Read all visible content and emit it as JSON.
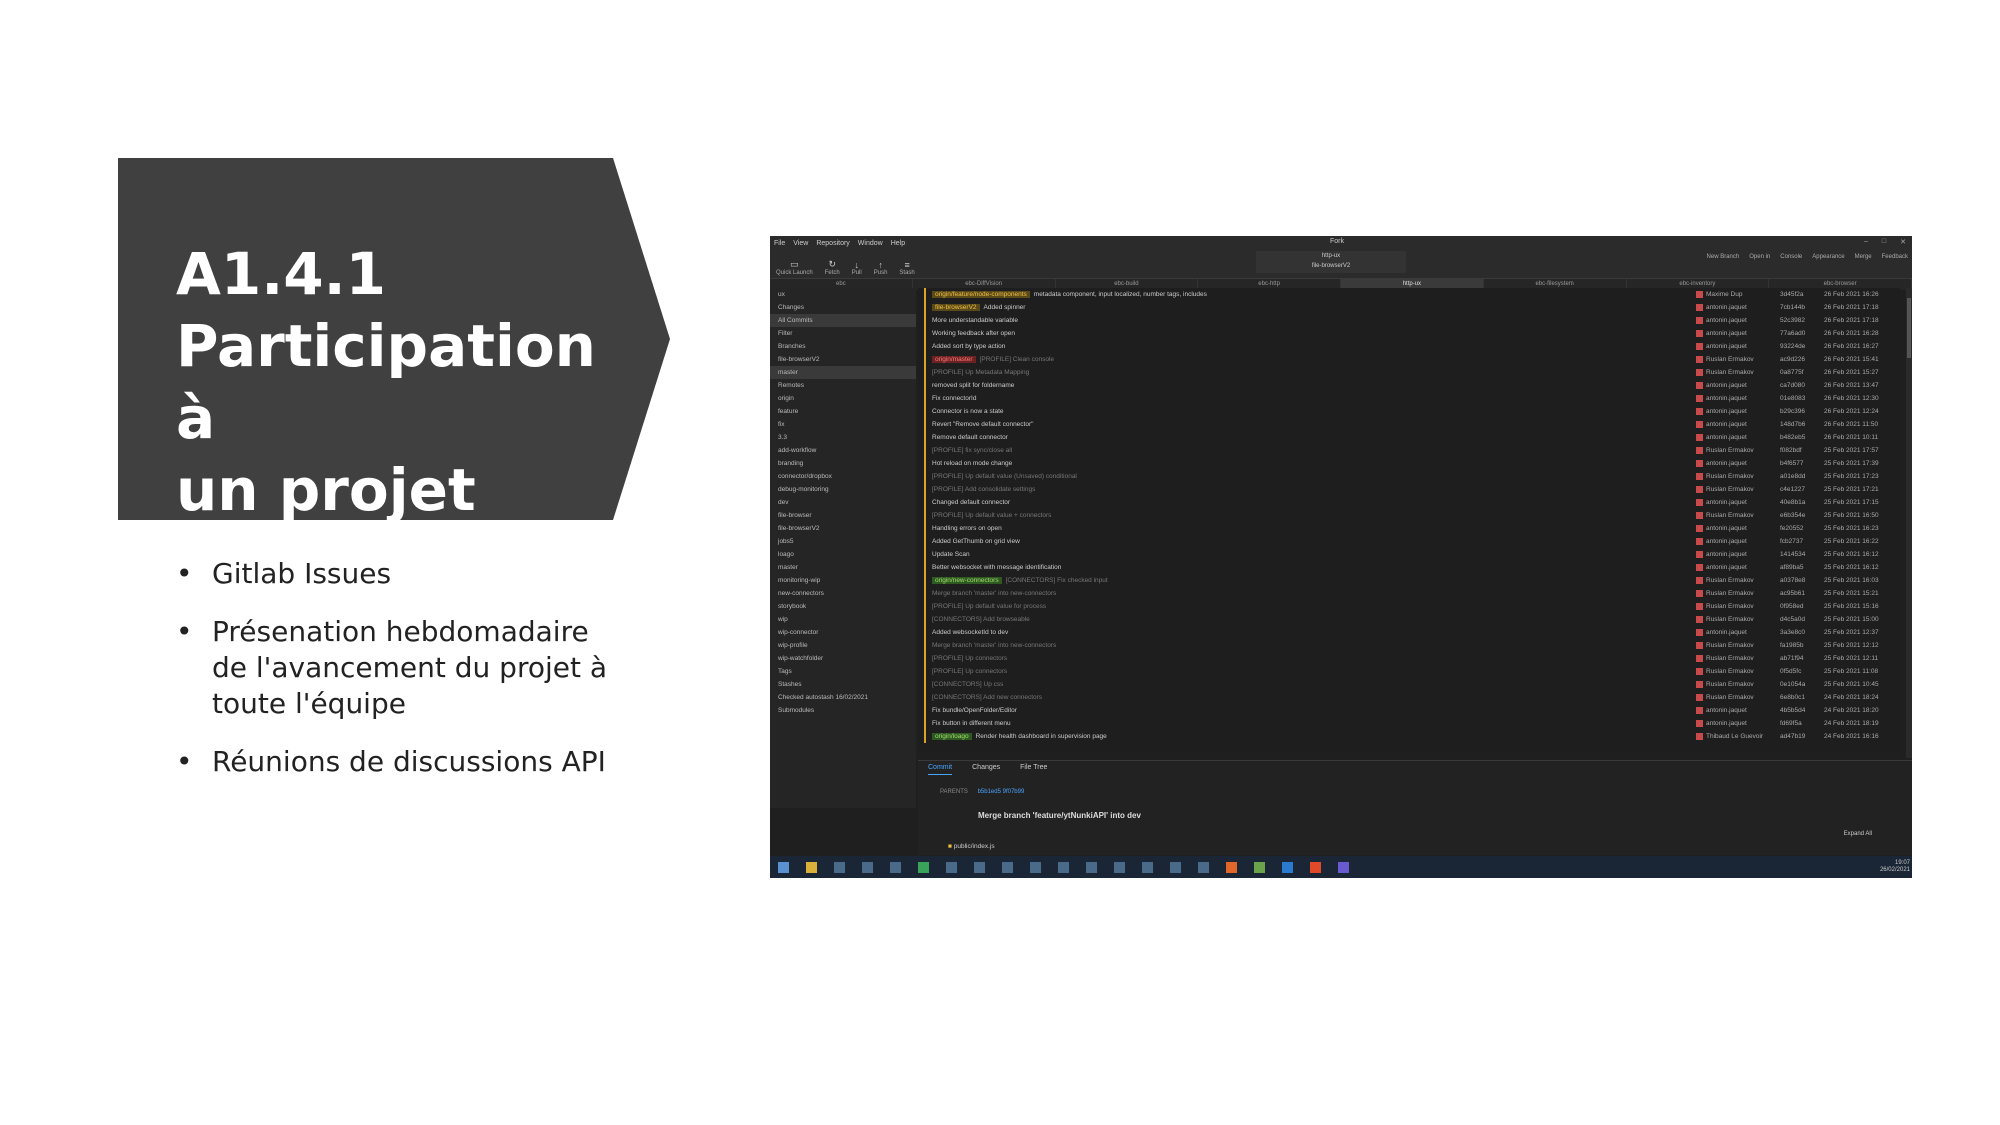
{
  "slide": {
    "title_lines": [
      "A1.4.1",
      "Participation à",
      "un projet"
    ],
    "bullets": [
      "Gitlab Issues",
      "Présenation hebdomadaire de l'avancement du projet à toute l'équipe",
      "Réunions de discussions API"
    ],
    "title_bg": "#404040"
  },
  "screenshot": {
    "menu": [
      "File",
      "View",
      "Repository",
      "Window",
      "Help"
    ],
    "app_title": "Fork",
    "toolbar": [
      {
        "icon": "folder-icon",
        "label": "Quick Launch"
      },
      {
        "icon": "fetch-icon",
        "label": "Fetch"
      },
      {
        "icon": "pull-icon",
        "label": "Pull"
      },
      {
        "icon": "push-icon",
        "label": "Push"
      },
      {
        "icon": "stash-icon",
        "label": "Stash"
      }
    ],
    "repo": {
      "name": "http-ux",
      "branch": "file-browserV2"
    },
    "right_tools": [
      "New Branch",
      "Open in",
      "Console",
      "Appearance",
      "Merge",
      "Feedback"
    ],
    "tabs": [
      "ebc",
      "ebc-DiffVision",
      "ebc-build",
      "ebc-http",
      "http-ux",
      "ebc-filesystem",
      "ebc-inventory",
      "ebc-browser"
    ],
    "active_tab": "http-ux",
    "sidebar": [
      "ux",
      "Changes",
      "All Commits",
      "Filter",
      "Branches",
      "file-browserV2",
      "master",
      "Remotes",
      "origin",
      "feature",
      "fix",
      "3.3",
      "add-workflow",
      "branding",
      "connector/dropbox",
      "debug-monitoring",
      "dev",
      "file-browser",
      "file-browserV2",
      "jobs5",
      "loago",
      "master",
      "monitoring-wip",
      "new-connectors",
      "storybook",
      "wip",
      "wip-connector",
      "wip-profile",
      "wip-watchfolder",
      "Tags",
      "Stashes",
      "Checked autostash 16/02/2021",
      "Submodules"
    ],
    "commits": [
      {
        "tag": "origin/feature/node-components",
        "msg": "metadata component, input localized, number tags, includes",
        "author": "Maxime Dup",
        "sha": "3d45f2a",
        "date": "26 Feb 2021 16:26"
      },
      {
        "tag": "file-browserV2",
        "msg": "Added spinner",
        "author": "antonin.jaquet",
        "sha": "7cb144b",
        "date": "26 Feb 2021 17:18"
      },
      {
        "tag": "",
        "msg": "More understandable variable",
        "author": "antonin.jaquet",
        "sha": "52c3982",
        "date": "26 Feb 2021 17:18"
      },
      {
        "tag": "",
        "msg": "Working feedback after open",
        "author": "antonin.jaquet",
        "sha": "77a6ad0",
        "date": "26 Feb 2021 16:28"
      },
      {
        "tag": "",
        "msg": "Added sort by type action",
        "author": "antonin.jaquet",
        "sha": "93224de",
        "date": "26 Feb 2021 16:27"
      },
      {
        "tag": "origin/master",
        "msg": "[PROFILE] Clean console",
        "author": "Ruslan Ermakov",
        "sha": "ac9d226",
        "date": "26 Feb 2021 15:41"
      },
      {
        "tag": "",
        "msg": "[PROFILE] Up Metadata Mapping",
        "author": "Ruslan Ermakov",
        "sha": "0a8775f",
        "date": "26 Feb 2021 15:27"
      },
      {
        "tag": "",
        "msg": "removed split for foldername",
        "author": "antonin.jaquet",
        "sha": "ca7d080",
        "date": "26 Feb 2021 13:47"
      },
      {
        "tag": "",
        "msg": "Fix connectorId",
        "author": "antonin.jaquet",
        "sha": "01e8083",
        "date": "26 Feb 2021 12:30"
      },
      {
        "tag": "",
        "msg": "Connector is now a state",
        "author": "antonin.jaquet",
        "sha": "b29c396",
        "date": "26 Feb 2021 12:24"
      },
      {
        "tag": "",
        "msg": "Revert \"Remove default connector\"",
        "author": "antonin.jaquet",
        "sha": "148d7b6",
        "date": "26 Feb 2021 11:50"
      },
      {
        "tag": "",
        "msg": "Remove default connector",
        "author": "antonin.jaquet",
        "sha": "b482eb5",
        "date": "26 Feb 2021 10:11"
      },
      {
        "tag": "",
        "msg": "[PROFILE] fix sync/close all",
        "author": "Ruslan Ermakov",
        "sha": "f082bdf",
        "date": "25 Feb 2021 17:57"
      },
      {
        "tag": "",
        "msg": "Hot reload on mode change",
        "author": "antonin.jaquet",
        "sha": "b4f6577",
        "date": "25 Feb 2021 17:39"
      },
      {
        "tag": "",
        "msg": "[PROFILE] Up default value (Unsaved) conditional",
        "author": "Ruslan Ermakov",
        "sha": "a01e8dd",
        "date": "25 Feb 2021 17:23"
      },
      {
        "tag": "",
        "msg": "[PROFILE] Add consolidate settings",
        "author": "Ruslan Ermakov",
        "sha": "c4e1227",
        "date": "25 Feb 2021 17:21"
      },
      {
        "tag": "",
        "msg": "Changed default connector",
        "author": "antonin.jaquet",
        "sha": "40e8b1a",
        "date": "25 Feb 2021 17:15"
      },
      {
        "tag": "",
        "msg": "[PROFILE] Up default value + connectors",
        "author": "Ruslan Ermakov",
        "sha": "e6b354e",
        "date": "25 Feb 2021 16:50"
      },
      {
        "tag": "",
        "msg": "Handling errors on open",
        "author": "antonin.jaquet",
        "sha": "fe20552",
        "date": "25 Feb 2021 16:23"
      },
      {
        "tag": "",
        "msg": "Added GetThumb on grid view",
        "author": "antonin.jaquet",
        "sha": "fcb2737",
        "date": "25 Feb 2021 16:22"
      },
      {
        "tag": "",
        "msg": "Update Scan",
        "author": "antonin.jaquet",
        "sha": "1414534",
        "date": "25 Feb 2021 16:12"
      },
      {
        "tag": "",
        "msg": "Better websocket with message identification",
        "author": "antonin.jaquet",
        "sha": "af89ba5",
        "date": "25 Feb 2021 16:12"
      },
      {
        "tag": "origin/new-connectors",
        "msg": "[CONNECTORS] Fix checked input",
        "author": "Ruslan Ermakov",
        "sha": "a0378e8",
        "date": "25 Feb 2021 16:03"
      },
      {
        "tag": "",
        "msg": "Merge branch 'master' into new-connectors",
        "author": "Ruslan Ermakov",
        "sha": "ac95b61",
        "date": "25 Feb 2021 15:21"
      },
      {
        "tag": "",
        "msg": "[PROFILE] Up default value for process",
        "author": "Ruslan Ermakov",
        "sha": "0f958ed",
        "date": "25 Feb 2021 15:16"
      },
      {
        "tag": "",
        "msg": "[CONNECTORS] Add browseable",
        "author": "Ruslan Ermakov",
        "sha": "d4c5a0d",
        "date": "25 Feb 2021 15:00"
      },
      {
        "tag": "",
        "msg": "Added websocketId to dev",
        "author": "antonin.jaquet",
        "sha": "3a3e8c0",
        "date": "25 Feb 2021 12:37"
      },
      {
        "tag": "",
        "msg": "Merge branch 'master' into new-connectors",
        "author": "Ruslan Ermakov",
        "sha": "fa1985b",
        "date": "25 Feb 2021 12:12"
      },
      {
        "tag": "",
        "msg": "[PROFILE] Up connectors",
        "author": "Ruslan Ermakov",
        "sha": "ab71f94",
        "date": "25 Feb 2021 12:11"
      },
      {
        "tag": "",
        "msg": "[PROFILE] Up connectors",
        "author": "Ruslan Ermakov",
        "sha": "0f5d5fc",
        "date": "25 Feb 2021 11:08"
      },
      {
        "tag": "",
        "msg": "[CONNECTORS] Up css",
        "author": "Ruslan Ermakov",
        "sha": "0e1054a",
        "date": "25 Feb 2021 10:45"
      },
      {
        "tag": "",
        "msg": "[CONNECTORS] Add new connectors",
        "author": "Ruslan Ermakov",
        "sha": "6e8b0c1",
        "date": "24 Feb 2021 18:24"
      },
      {
        "tag": "",
        "msg": "Fix bundle/OpenFolder/Editor",
        "author": "antonin.jaquet",
        "sha": "4b5b5d4",
        "date": "24 Feb 2021 18:20"
      },
      {
        "tag": "",
        "msg": "Fix button in different menu",
        "author": "antonin.jaquet",
        "sha": "fd69f5a",
        "date": "24 Feb 2021 18:19"
      },
      {
        "tag": "origin/loago",
        "msg": "Render health dashboard in supervision page",
        "author": "Thibaud Le Guevoir",
        "sha": "ad47b19",
        "date": "24 Feb 2021 16:16"
      }
    ],
    "detail_tabs": [
      "Commit",
      "Changes",
      "File Tree"
    ],
    "parents_label": "PARENTS",
    "parents_value": "b5b1ed5 9f07b99",
    "merge_message": "Merge branch 'feature/ytNunkiAPI' into dev",
    "expand_label": "Expand All",
    "file_path": "public/index.js",
    "clock": {
      "time": "19:07",
      "date": "26/02/2021"
    }
  }
}
